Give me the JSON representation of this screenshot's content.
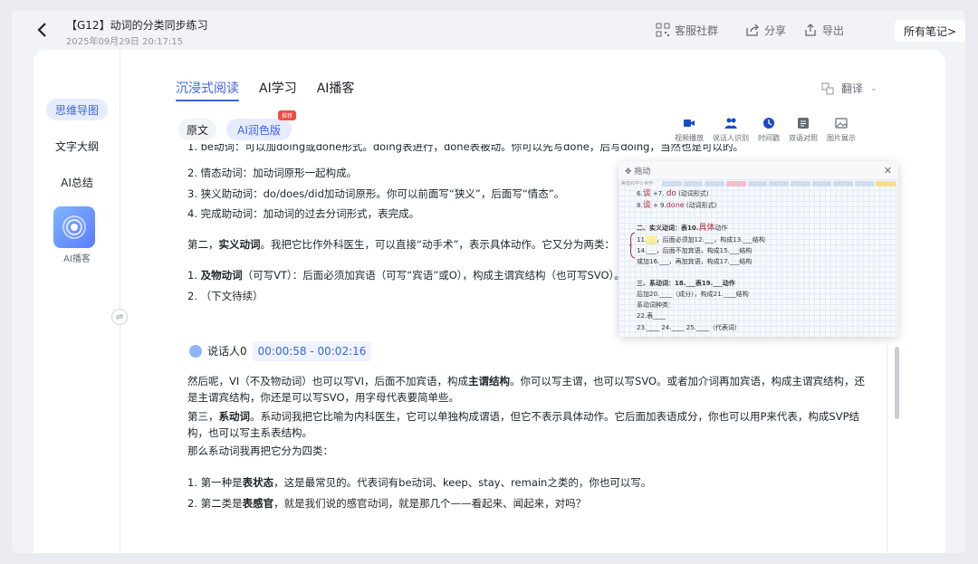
{
  "header": {
    "title": "【G12】动词的分类同步练习",
    "date": "2025年09月29日 20:17:15",
    "service_group": "客服社群",
    "share": "分享",
    "export": "导出",
    "all_notes": "所有笔记>"
  },
  "sidebar": {
    "items": [
      "思维导图",
      "文字大纲",
      "AI总结"
    ],
    "ai_podcast_label": "AI播客"
  },
  "tabs": [
    "沉浸式阅读",
    "AI学习",
    "AI播客"
  ],
  "translate": "翻译",
  "mode": {
    "original": "原文",
    "ai_polish": "AI润色版",
    "badge": "推荐"
  },
  "tools": [
    "视频播放",
    "说话人识别",
    "时间戳",
    "双语对照",
    "图片展示"
  ],
  "popup": {
    "title": "拖动",
    "header_text": "美音的平行世界",
    "notes": [
      {
        "text": "6.",
        "hw": "谈",
        "text2": "+7.",
        "hw2": "do",
        "text3": "(动词形式)"
      },
      {
        "text": "8.",
        "hw": "谈",
        "text2": "+ 9.",
        "hw2": "done",
        "text3": "(动词形式)"
      },
      {
        "text": "二、实义动词：表10.",
        "hw": "具体",
        "text2": "动作"
      },
      {
        "text": "11.___，后面必须加12.___，构成13.___结构"
      },
      {
        "text": "14.___，后面不加宾语，构成15.___结构"
      },
      {
        "text": "或加16.___，再加宾语，构成17.___结构"
      },
      {
        "text": "三、系动词：18.___表19.___动作"
      },
      {
        "text": "后加20.____（成分），构成21.____结构"
      },
      {
        "text": "系动词种类："
      },
      {
        "text": "22.表____"
      },
      {
        "text": "23.____ 24.____ 25.____（代表词）"
      }
    ]
  },
  "content": {
    "line_cut": "1. be动词：可以加doing或done形式。doing表进行，done表被动。你可以先写done，后写doing，当然也是可以的。",
    "l2": "2. 情态动词：加动词原形一起构成。",
    "l3": "3. 狭义助动词：do/does/did加动词原形。你可以前面写“狭义”，后面写“情态”。",
    "l4": "4. 完成助动词：加动词的过去分词形式，表完成。",
    "p2_a": "第二，",
    "p2_b": "实义动词",
    "p2_c": "。我把它比作外科医生，可以直接“动手术”，表示具体动作。它又分为两类：",
    "p3_a": "1. ",
    "p3_b": "及物动词",
    "p3_c": "（可写VT）：后面必须加宾语（可写“宾语”或O），构成主谓宾结构（也可写SVO）。",
    "p4": "2. （下文待续）",
    "speaker": "说话人0",
    "timestamp": "00:00:58 - 00:02:16",
    "p5_a": "然后呢，VI（不及物动词）也可以写VI，后面不加宾语，构成",
    "p5_b": "主谓结构",
    "p5_c": "。你可以写主谓，也可以写SVO。或者加介词再加宾语，构成主谓宾结构，还是主谓宾结构，你还是可以写SVO，用字母代表要简单些。",
    "p6_a": "第三，",
    "p6_b": "系动词",
    "p6_c": "。系动词我把它比喻为内科医生，它可以单独构成谓语，但它不表示具体动作。它后面加表语成分，你也可以用P来代表，构成SVP结构，也可以写主系表结构。",
    "p7": "那么系动词我再把它分为四类：",
    "p8_a": "1. 第一种是",
    "p8_b": "表状态",
    "p8_c": "，这是最常见的。代表词有be动词、keep、stay、remain之类的，你也可以写。",
    "p9_a": "2. 第二类是",
    "p9_b": "表感官",
    "p9_c": "，就是我们说的感官动词，就是那几个——看起来、闻起来，对吗？"
  }
}
